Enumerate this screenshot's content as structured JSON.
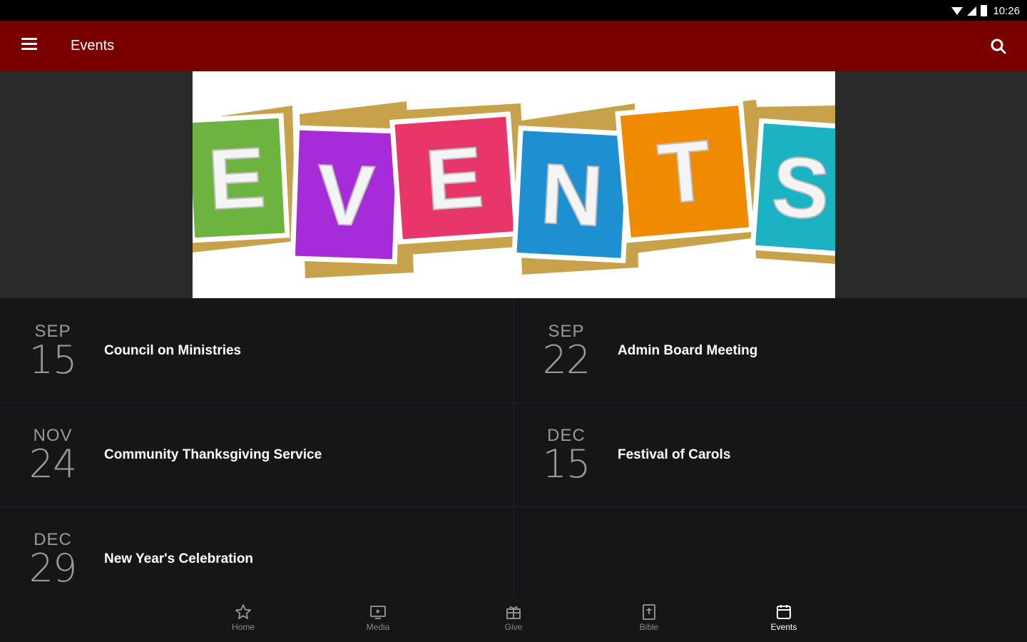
{
  "status_bar": {
    "time": "10:26"
  },
  "app_bar": {
    "title": "Events"
  },
  "banner": {
    "letters": [
      "E",
      "V",
      "E",
      "N",
      "T",
      "S"
    ],
    "colors": [
      "#6db33f",
      "#a62bd9",
      "#e8366a",
      "#1e8fd0",
      "#f08a00",
      "#1bb3c4"
    ]
  },
  "events": [
    {
      "month": "SEP",
      "day": "15",
      "name": "Council on Ministries"
    },
    {
      "month": "SEP",
      "day": "22",
      "name": "Admin Board Meeting"
    },
    {
      "month": "NOV",
      "day": "24",
      "name": "Community Thanksgiving Service"
    },
    {
      "month": "DEC",
      "day": "15",
      "name": "Festival of Carols"
    },
    {
      "month": "DEC",
      "day": "29",
      "name": "New Year's Celebration"
    }
  ],
  "bottom_nav": [
    {
      "label": "Home",
      "icon": "star-icon"
    },
    {
      "label": "Media",
      "icon": "tv-play-icon"
    },
    {
      "label": "Give",
      "icon": "gift-icon"
    },
    {
      "label": "Bible",
      "icon": "book-cross-icon"
    },
    {
      "label": "Events",
      "icon": "calendar-icon",
      "active": true
    }
  ],
  "colors": {
    "app_bar": "#7a0000",
    "background": "#161618",
    "hero_bg": "#2a2a2a"
  }
}
